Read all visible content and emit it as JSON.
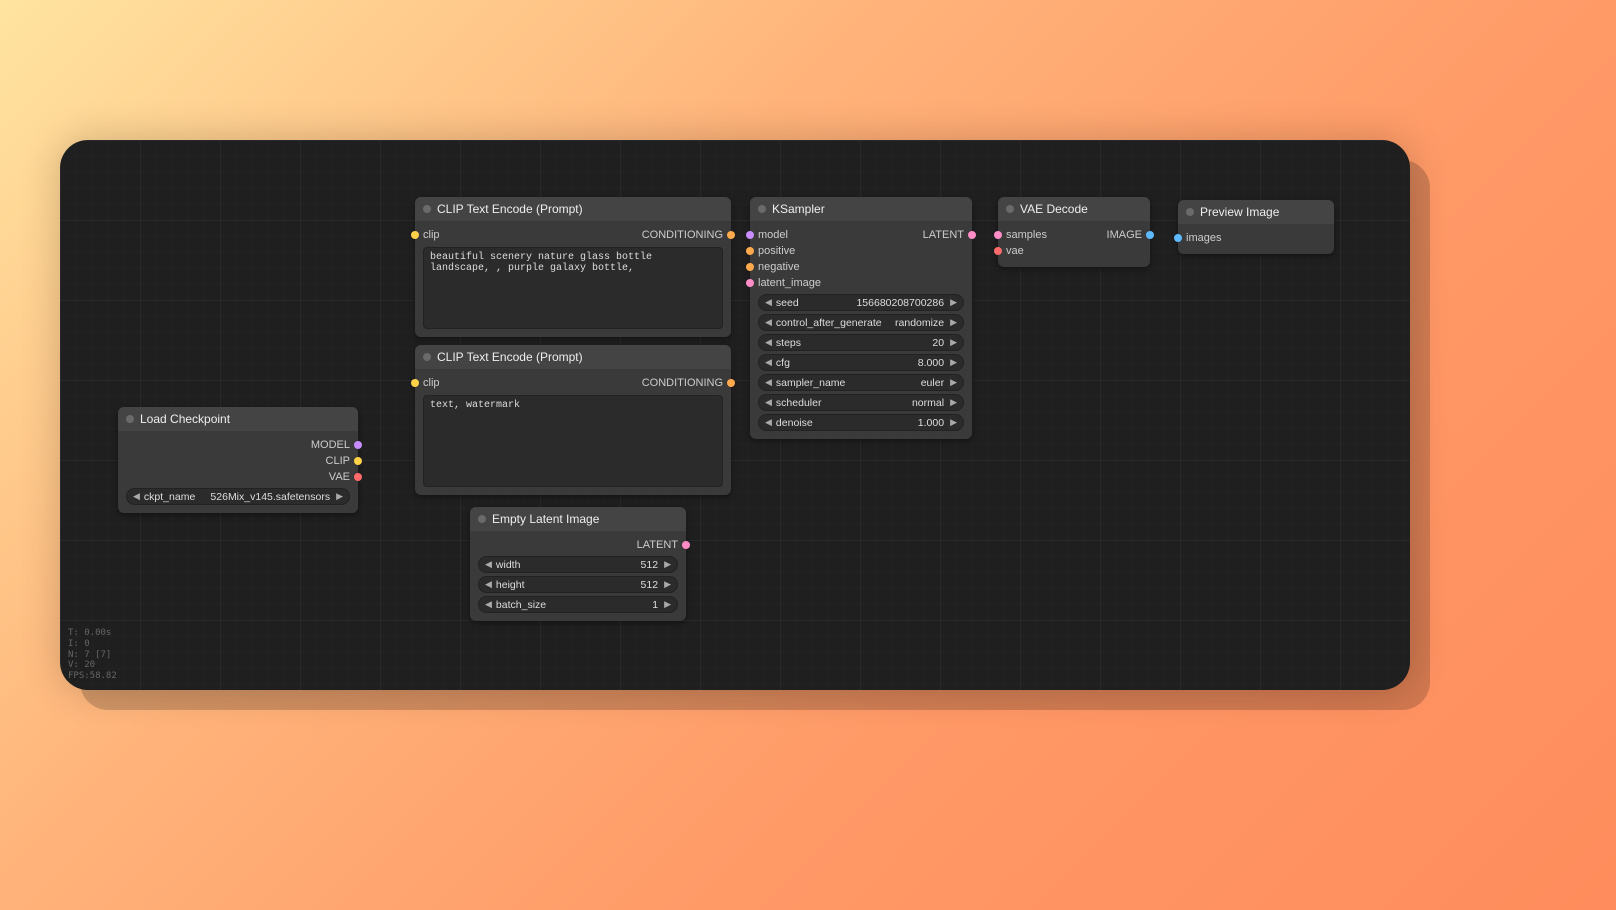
{
  "stats": {
    "line1": "T: 0.00s",
    "line2": "I: 0",
    "line3": "N: 7 [7]",
    "line4": "V: 20",
    "line5": "FPS:58.82"
  },
  "nodes": {
    "load_checkpoint": {
      "title": "Load Checkpoint",
      "out_model": "MODEL",
      "out_clip": "CLIP",
      "out_vae": "VAE",
      "ckpt_name_label": "ckpt_name",
      "ckpt_name_value": "526Mix_v145.safetensors"
    },
    "clip_pos": {
      "title": "CLIP Text Encode (Prompt)",
      "in_clip": "clip",
      "out_cond": "CONDITIONING",
      "text": "beautiful scenery nature glass bottle landscape, , purple galaxy bottle,"
    },
    "clip_neg": {
      "title": "CLIP Text Encode (Prompt)",
      "in_clip": "clip",
      "out_cond": "CONDITIONING",
      "text": "text, watermark"
    },
    "empty_latent": {
      "title": "Empty Latent Image",
      "out_latent": "LATENT",
      "width_label": "width",
      "width_value": "512",
      "height_label": "height",
      "height_value": "512",
      "batch_label": "batch_size",
      "batch_value": "1"
    },
    "ksampler": {
      "title": "KSampler",
      "in_model": "model",
      "in_positive": "positive",
      "in_negative": "negative",
      "in_latent": "latent_image",
      "out_latent": "LATENT",
      "seed_label": "seed",
      "seed_value": "156680208700286",
      "ctrl_label": "control_after_generate",
      "ctrl_value": "randomize",
      "steps_label": "steps",
      "steps_value": "20",
      "cfg_label": "cfg",
      "cfg_value": "8.000",
      "sampler_label": "sampler_name",
      "sampler_value": "euler",
      "sched_label": "scheduler",
      "sched_value": "normal",
      "denoise_label": "denoise",
      "denoise_value": "1.000"
    },
    "vae_decode": {
      "title": "VAE Decode",
      "in_samples": "samples",
      "in_vae": "vae",
      "out_image": "IMAGE"
    },
    "preview": {
      "title": "Preview Image",
      "in_images": "images"
    }
  }
}
